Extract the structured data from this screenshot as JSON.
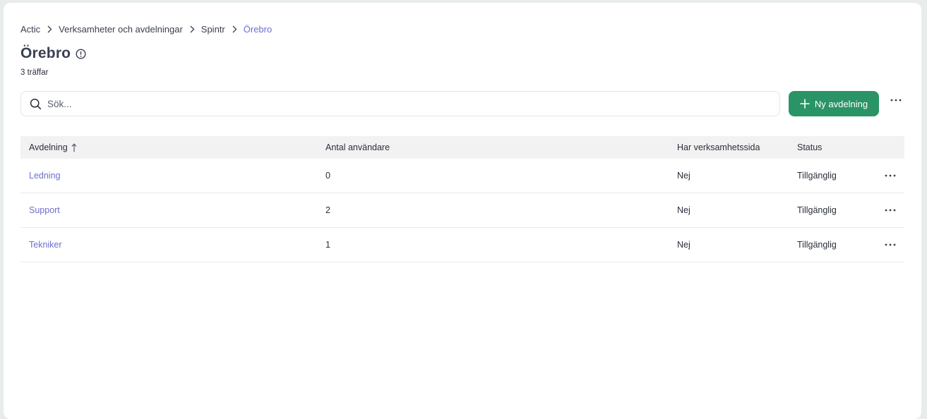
{
  "breadcrumb": {
    "items": [
      {
        "label": "Actic"
      },
      {
        "label": "Verksamheter och avdelningar"
      },
      {
        "label": "Spintr"
      },
      {
        "label": "Örebro"
      }
    ]
  },
  "header": {
    "title": "Örebro",
    "hits": "3 träffar"
  },
  "search": {
    "placeholder": "Sök...",
    "value": ""
  },
  "toolbar": {
    "new_button_label": "Ny avdelning"
  },
  "table": {
    "columns": {
      "department": "Avdelning",
      "users": "Antal användare",
      "has_page": "Har verksamhetssida",
      "status": "Status"
    },
    "rows": [
      {
        "department": "Ledning",
        "users": "0",
        "has_page": "Nej",
        "status": "Tillgänglig"
      },
      {
        "department": "Support",
        "users": "2",
        "has_page": "Nej",
        "status": "Tillgänglig"
      },
      {
        "department": "Tekniker",
        "users": "1",
        "has_page": "Nej",
        "status": "Tillgänglig"
      }
    ]
  },
  "colors": {
    "accent_link": "#6b6fd0",
    "primary_button": "#2a9466",
    "header_bg": "#f2f2f2"
  },
  "icons": {
    "breadcrumb_separator": "chevron-right-icon",
    "title_info": "info-icon",
    "search": "search-icon",
    "new_button": "plus-icon",
    "more": "more-horizontal-icon",
    "sort": "arrow-up-icon"
  }
}
